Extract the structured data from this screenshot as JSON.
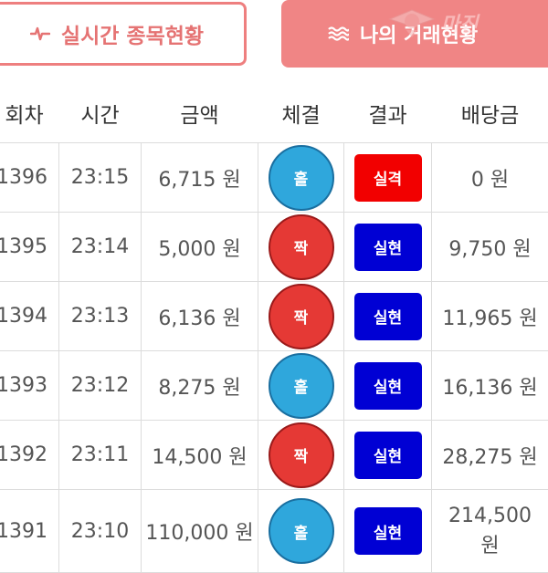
{
  "tabs": {
    "realtime_label": "실시간 종목현황",
    "my_trades_label": "나의 거래현황"
  },
  "watermark": {
    "text": "마진"
  },
  "table": {
    "headers": [
      "회차",
      "시간",
      "금액",
      "체결",
      "결과",
      "배당금"
    ],
    "rows": [
      {
        "round": "1396",
        "time": "23:15",
        "amount": "6,715 원",
        "result": "홀",
        "result_color": "blue",
        "outcome": "실격",
        "outcome_type": "fail",
        "payout": "0 원"
      },
      {
        "round": "1395",
        "time": "23:14",
        "amount": "5,000 원",
        "result": "짝",
        "result_color": "red",
        "outcome": "실현",
        "outcome_type": "win",
        "payout": "9,750 원"
      },
      {
        "round": "1394",
        "time": "23:13",
        "amount": "6,136 원",
        "result": "짝",
        "result_color": "red",
        "outcome": "실현",
        "outcome_type": "win",
        "payout": "11,965 원"
      },
      {
        "round": "1393",
        "time": "23:12",
        "amount": "8,275 원",
        "result": "홀",
        "result_color": "blue",
        "outcome": "실현",
        "outcome_type": "win",
        "payout": "16,136 원"
      },
      {
        "round": "1392",
        "time": "23:11",
        "amount": "14,500 원",
        "result": "짝",
        "result_color": "red",
        "outcome": "실현",
        "outcome_type": "win",
        "payout": "28,275 원"
      },
      {
        "round": "1391",
        "time": "23:10",
        "amount": "110,000 원",
        "result": "홀",
        "result_color": "blue",
        "outcome": "실현",
        "outcome_type": "win",
        "payout_line1": "214,500",
        "payout_line2": "원"
      }
    ]
  },
  "colors": {
    "tab_accent": "#ee7f7f",
    "tab_active_bg": "#f08585",
    "odd_ball": "#2fa7dc",
    "even_ball": "#e53935",
    "fail_badge": "#f20000",
    "win_badge": "#0000d4"
  },
  "icons": {
    "realtime": "pulse-icon",
    "my_trades": "waves-icon"
  }
}
